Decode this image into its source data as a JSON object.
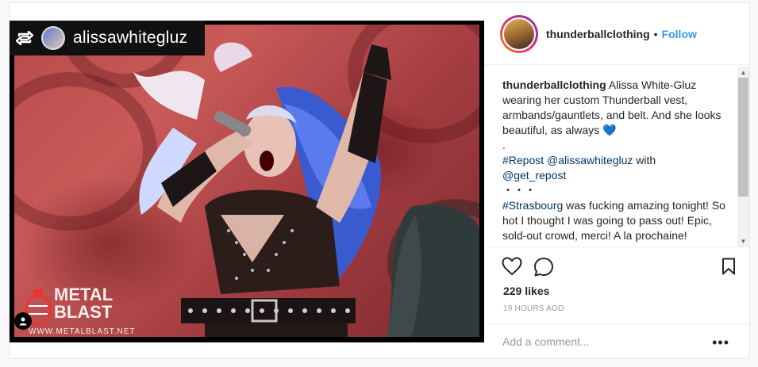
{
  "media": {
    "repost_user": "alissawhitegluz",
    "logo_text_line1": "METAL",
    "logo_text_line2": "BLAST",
    "logo_url": "WWW.METALBLAST.NET"
  },
  "header": {
    "username": "thunderballclothing",
    "separator": "•",
    "follow_label": "Follow"
  },
  "caption": {
    "author": "thunderballclothing",
    "text_1": " Alissa White-Gluz wearing her custom Thunderball vest, armbands/gauntlets, and belt. And she looks beautiful, as always ",
    "emoji": "💙",
    "dot_1": ".",
    "hashtag_repost": "#Repost",
    "mention_1": "@alissawhitegluz",
    "text_with": " with",
    "mention_2": "@get_repost",
    "dots_line": "・・・",
    "hashtag_strasbourg": "#Strasbourg",
    "text_2": " was fucking amazing tonight! So hot I thought I was going to pass out! Epic, sold-out crowd, merci! A la prochaine!",
    "dot_2": "."
  },
  "actions": {
    "likes": "229 likes",
    "timestamp": "19 HOURS AGO",
    "comment_placeholder": "Add a comment...",
    "more_label": "•••"
  },
  "icons": [
    "repost-icon",
    "heart-icon",
    "comment-icon",
    "bookmark-icon",
    "user-tag-icon",
    "scroll-up-icon",
    "scroll-down-icon"
  ]
}
